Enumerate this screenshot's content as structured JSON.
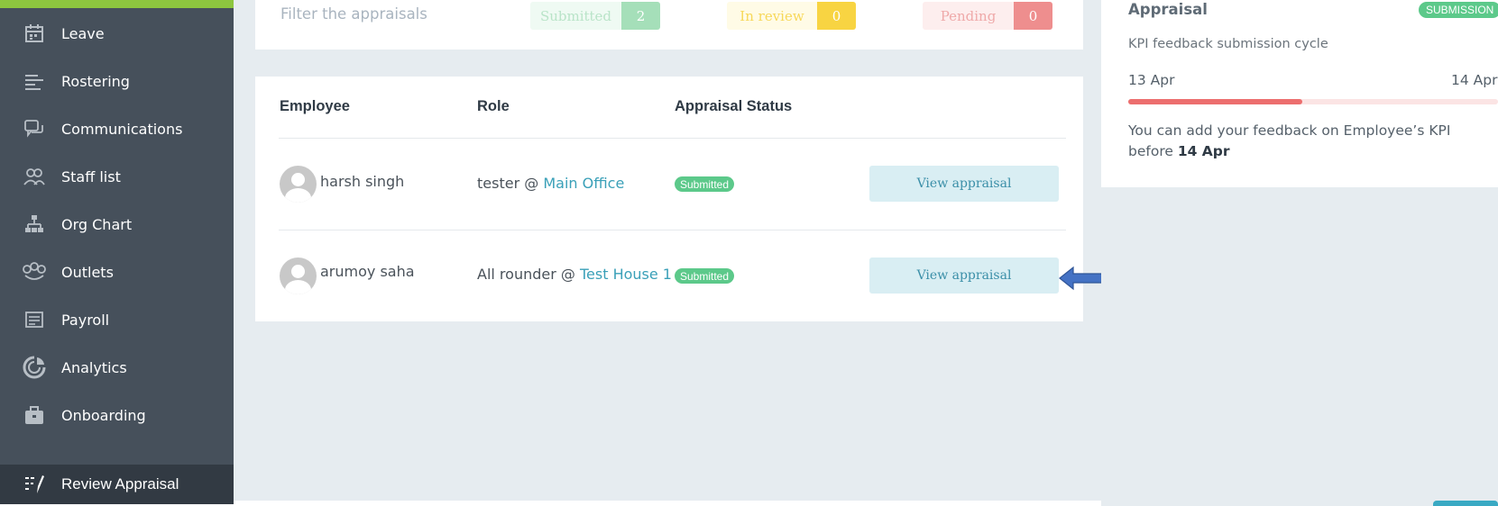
{
  "sidebar": {
    "items": [
      {
        "label": "Leave",
        "icon": "calendar-icon"
      },
      {
        "label": "Rostering",
        "icon": "roster-lines-icon"
      },
      {
        "label": "Communications",
        "icon": "chat-bubbles-icon"
      },
      {
        "label": "Staff list",
        "icon": "people-icon"
      },
      {
        "label": "Org Chart",
        "icon": "org-chart-icon"
      },
      {
        "label": "Outlets",
        "icon": "outlets-icon"
      },
      {
        "label": "Payroll",
        "icon": "payroll-icon"
      },
      {
        "label": "Analytics",
        "icon": "analytics-icon"
      },
      {
        "label": "Onboarding",
        "icon": "briefcase-icon"
      },
      {
        "label": "Review Appraisal",
        "icon": "review-pen-icon",
        "active": true
      }
    ]
  },
  "filter": {
    "title": "Filter the appraisals",
    "submitted": {
      "label": "Submitted",
      "count": "2"
    },
    "in_review": {
      "label": "In review",
      "count": "0"
    },
    "pending": {
      "label": "Pending",
      "count": "0"
    }
  },
  "table": {
    "headers": {
      "employee": "Employee",
      "role": "Role",
      "status": "Appraisal Status"
    },
    "rows": [
      {
        "name": "harsh singh",
        "role": "tester @ ",
        "location": "Main Office",
        "status": "Submitted",
        "action": "View appraisal"
      },
      {
        "name": "arumoy saha",
        "role": "All rounder @ ",
        "location": "Test House 1",
        "status": "Submitted",
        "action": "View appraisal"
      }
    ]
  },
  "appraisal": {
    "title": "Appraisal",
    "badge": "SUBMISSION",
    "subtitle": "KPI feedback submission cycle",
    "start_date": "13 Apr",
    "end_date": "14 Apr",
    "progress": 0.47,
    "note_prefix": "You can add your feedback on Employee’s KPI before ",
    "note_date": "14 Apr"
  },
  "colors": {
    "sidebar_bg": "#46505b",
    "sidebar_active": "#323a43",
    "accent_green": "#8dc63f",
    "status_green": "#5cc98a",
    "progress_red": "#ec6e6e",
    "link_teal": "#3aa0b8",
    "arrow_blue": "#4472c4"
  }
}
